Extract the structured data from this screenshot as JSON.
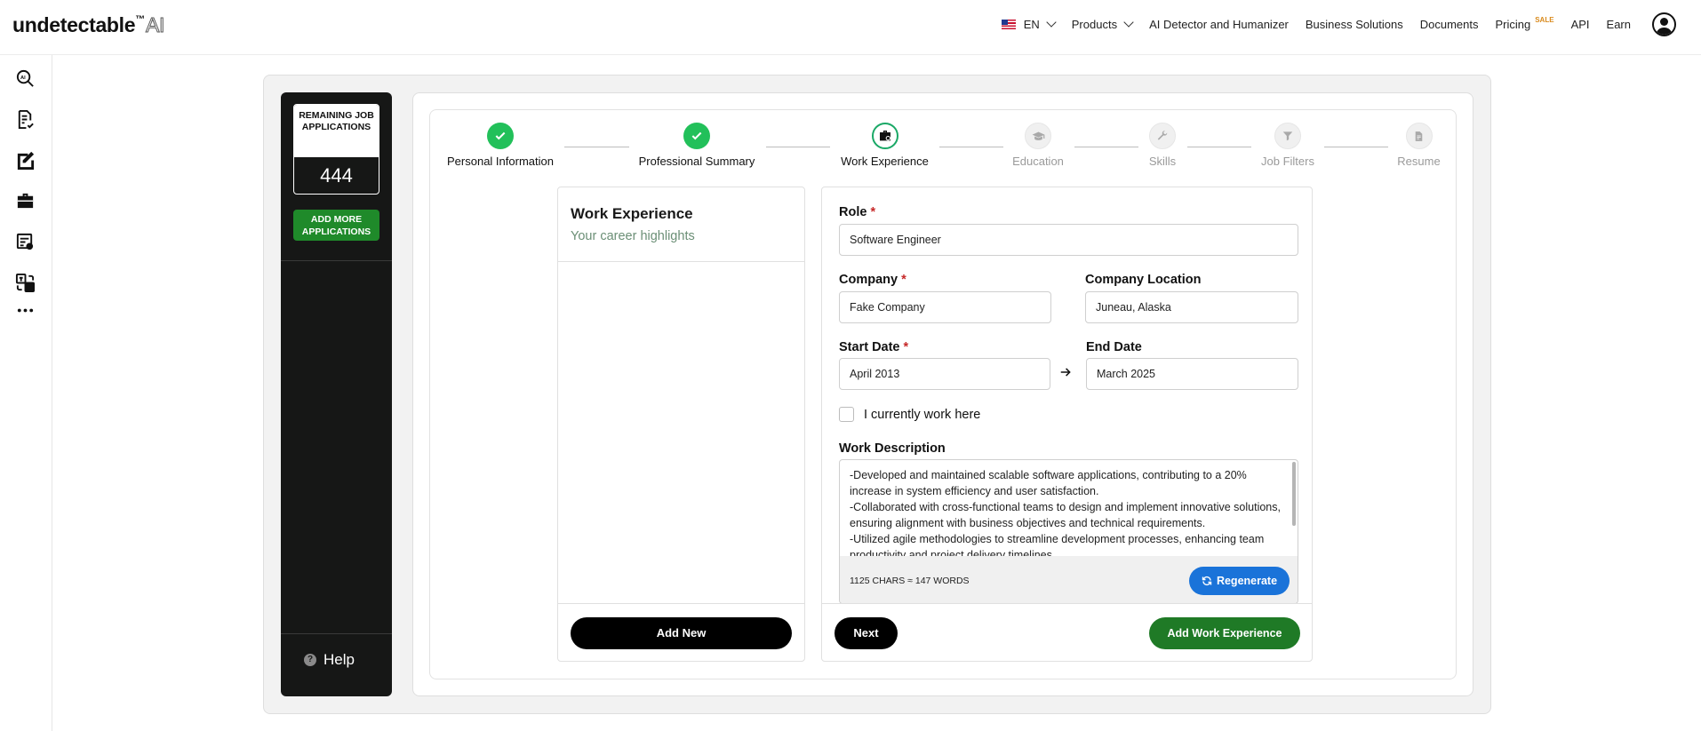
{
  "brand": {
    "name": "undetectable",
    "tm": "™",
    "ai": "AI"
  },
  "nav": {
    "language": "EN",
    "products": "Products",
    "detector": "AI Detector and Humanizer",
    "business": "Business Solutions",
    "documents": "Documents",
    "pricing": "Pricing",
    "sale": "SALE",
    "api": "API",
    "earn": "Earn"
  },
  "credits": {
    "label": "REMAINING JOB APPLICATIONS",
    "count": "444",
    "add_more": "ADD MORE APPLICATIONS",
    "help": "Help"
  },
  "stepper": {
    "steps": [
      {
        "label": "Personal Information",
        "state": "done"
      },
      {
        "label": "Professional Summary",
        "state": "done"
      },
      {
        "label": "Work Experience",
        "state": "active"
      },
      {
        "label": "Education",
        "state": "todo"
      },
      {
        "label": "Skills",
        "state": "todo"
      },
      {
        "label": "Job Filters",
        "state": "todo"
      },
      {
        "label": "Resume",
        "state": "todo"
      }
    ]
  },
  "experience_list": {
    "title": "Work Experience",
    "subtitle": "Your career highlights",
    "add_new": "Add New"
  },
  "form": {
    "role_label": "Role",
    "role_value": "Software Engineer",
    "company_label": "Company",
    "company_value": "Fake Company",
    "location_label": "Company Location",
    "location_value": "Juneau, Alaska",
    "start_label": "Start Date",
    "start_value": "April 2013",
    "end_label": "End Date",
    "end_value": "March 2025",
    "required_mark": "*",
    "current_label": "I currently work here",
    "current_checked": false,
    "description_label": "Work Description",
    "description_value": "-Developed and maintained scalable software applications, contributing to a 20% increase in system efficiency and user satisfaction.\n-Collaborated with cross-functional teams to design and implement innovative solutions, ensuring alignment with business objectives and technical requirements.\n-Utilized agile methodologies to streamline development processes, enhancing team productivity and project delivery timelines.",
    "counter": "1125 CHARS ≈ 147 WORDS",
    "regenerate": "Regenerate",
    "next": "Next",
    "add_work": "Add Work Experience"
  },
  "colors": {
    "accent_green": "#1f7a26",
    "step_done": "#22c05a",
    "regen_blue": "#1a73d9",
    "required_red": "#c62828",
    "dark_panel": "#161716"
  }
}
